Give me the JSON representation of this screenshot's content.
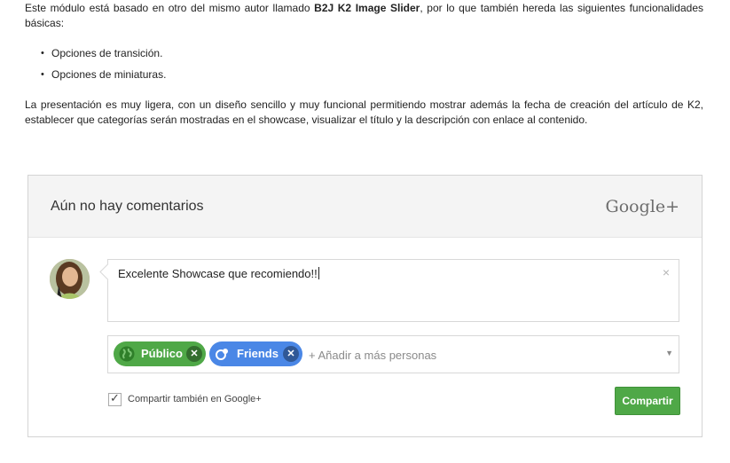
{
  "article": {
    "intro_pre": "Este módulo está basado en otro del mismo autor llamado ",
    "intro_bold": "B2J K2 Image Slider",
    "intro_post": ", por lo que también hereda las siguientes funcionalidades básicas:",
    "bullets": [
      "Opciones de transición.",
      "Opciones de miniaturas."
    ],
    "paragraph": "La presentación es muy ligera, con un diseño sencillo y muy funcional permitiendo mostrar además la fecha de creación del artículo de K2, establecer que categorías serán mostradas en el showcase, visualizar el título y la descripción con enlace al contenido."
  },
  "comments": {
    "title": "Aún no hay comentarios",
    "brand": "Google+",
    "compose_text": "Excelente Showcase que recomiendo!!",
    "close_glyph": "×",
    "chips": [
      {
        "label": "Público",
        "icon": "globe-icon",
        "color": "#4fa847"
      },
      {
        "label": "Friends",
        "icon": "circles-icon",
        "color": "#4a87e6"
      }
    ],
    "add_people": "+ Añadir a más personas",
    "dropdown_glyph": "▼",
    "share_checkbox_label": "Compartir también en Google+",
    "share_checked": true,
    "submit_label": "Compartir",
    "accent": "#4fa847"
  }
}
